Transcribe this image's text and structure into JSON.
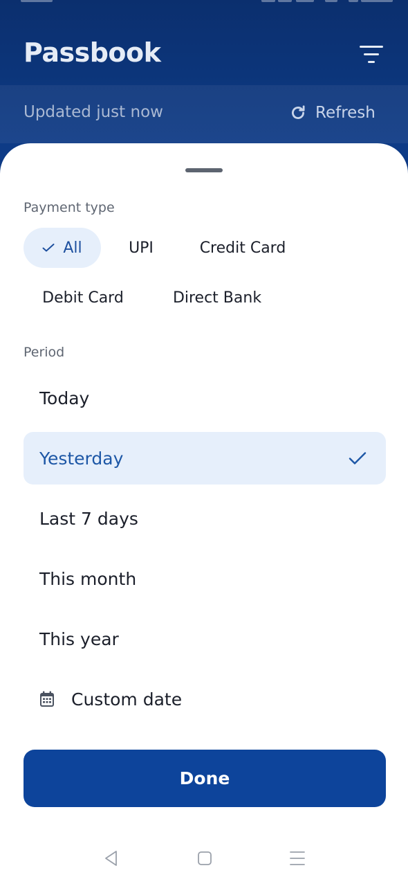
{
  "header": {
    "title": "Passbook",
    "updated_text": "Updated just now",
    "refresh_label": "Refresh"
  },
  "payment_type": {
    "label": "Payment type",
    "options": [
      {
        "label": "All",
        "selected": true
      },
      {
        "label": "UPI",
        "selected": false
      },
      {
        "label": "Credit Card",
        "selected": false
      },
      {
        "label": "Debit Card",
        "selected": false
      },
      {
        "label": "Direct Bank",
        "selected": false
      }
    ]
  },
  "period": {
    "label": "Period",
    "options": [
      {
        "label": "Today",
        "selected": false
      },
      {
        "label": "Yesterday",
        "selected": true
      },
      {
        "label": "Last 7 days",
        "selected": false
      },
      {
        "label": "This month",
        "selected": false
      },
      {
        "label": "This year",
        "selected": false
      },
      {
        "label": "Custom date",
        "selected": false,
        "icon": "calendar-icon"
      }
    ]
  },
  "done_label": "Done",
  "colors": {
    "header_bg": "#0e3c88",
    "accent": "#0d449b",
    "selected_bg": "#e6effb",
    "selected_text": "#1d57a6"
  }
}
